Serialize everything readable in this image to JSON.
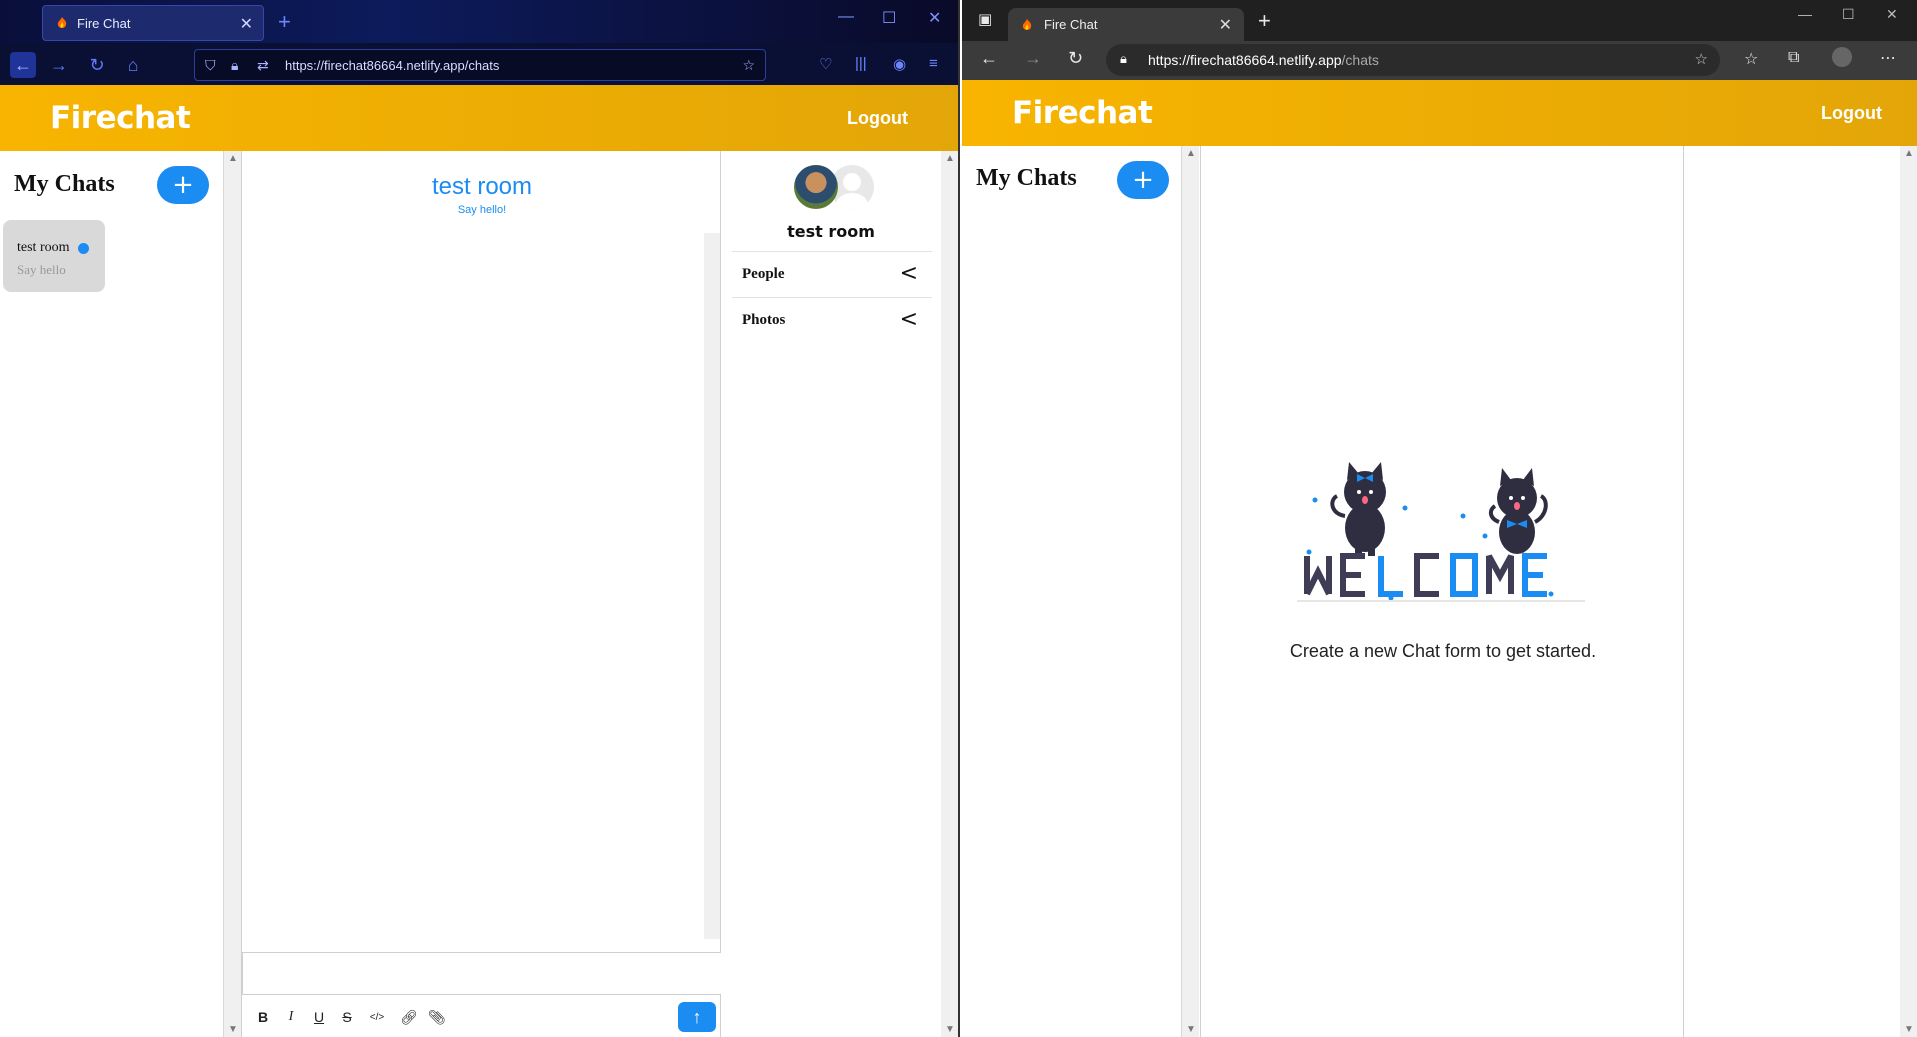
{
  "left_browser": {
    "tab_title": "Fire Chat",
    "url": "https://firechat86664.netlify.app/chats"
  },
  "right_browser": {
    "tab_title": "Fire Chat",
    "url_host": "https://firechat86664.netlify.app",
    "url_path": "/chats"
  },
  "app": {
    "brand": "Firechat",
    "logout": "Logout",
    "sidebar_title": "My Chats",
    "add_label": "+",
    "accent_color": "#1b8cf2",
    "header_color": "#f8b400"
  },
  "chats": [
    {
      "name": "test room",
      "preview": "Say hello",
      "unread": true
    }
  ],
  "active_chat": {
    "title": "test room",
    "subtitle": "Say hello!",
    "info_title": "test room",
    "sections": [
      "People",
      "Photos"
    ]
  },
  "composer": {
    "tools": [
      "B",
      "I",
      "U",
      "S",
      "</>",
      "link",
      "attach"
    ],
    "send_icon": "arrow-up-icon"
  },
  "welcome": {
    "caption": "Create a new Chat form to get started.",
    "illustration_word": "WELCOME"
  }
}
